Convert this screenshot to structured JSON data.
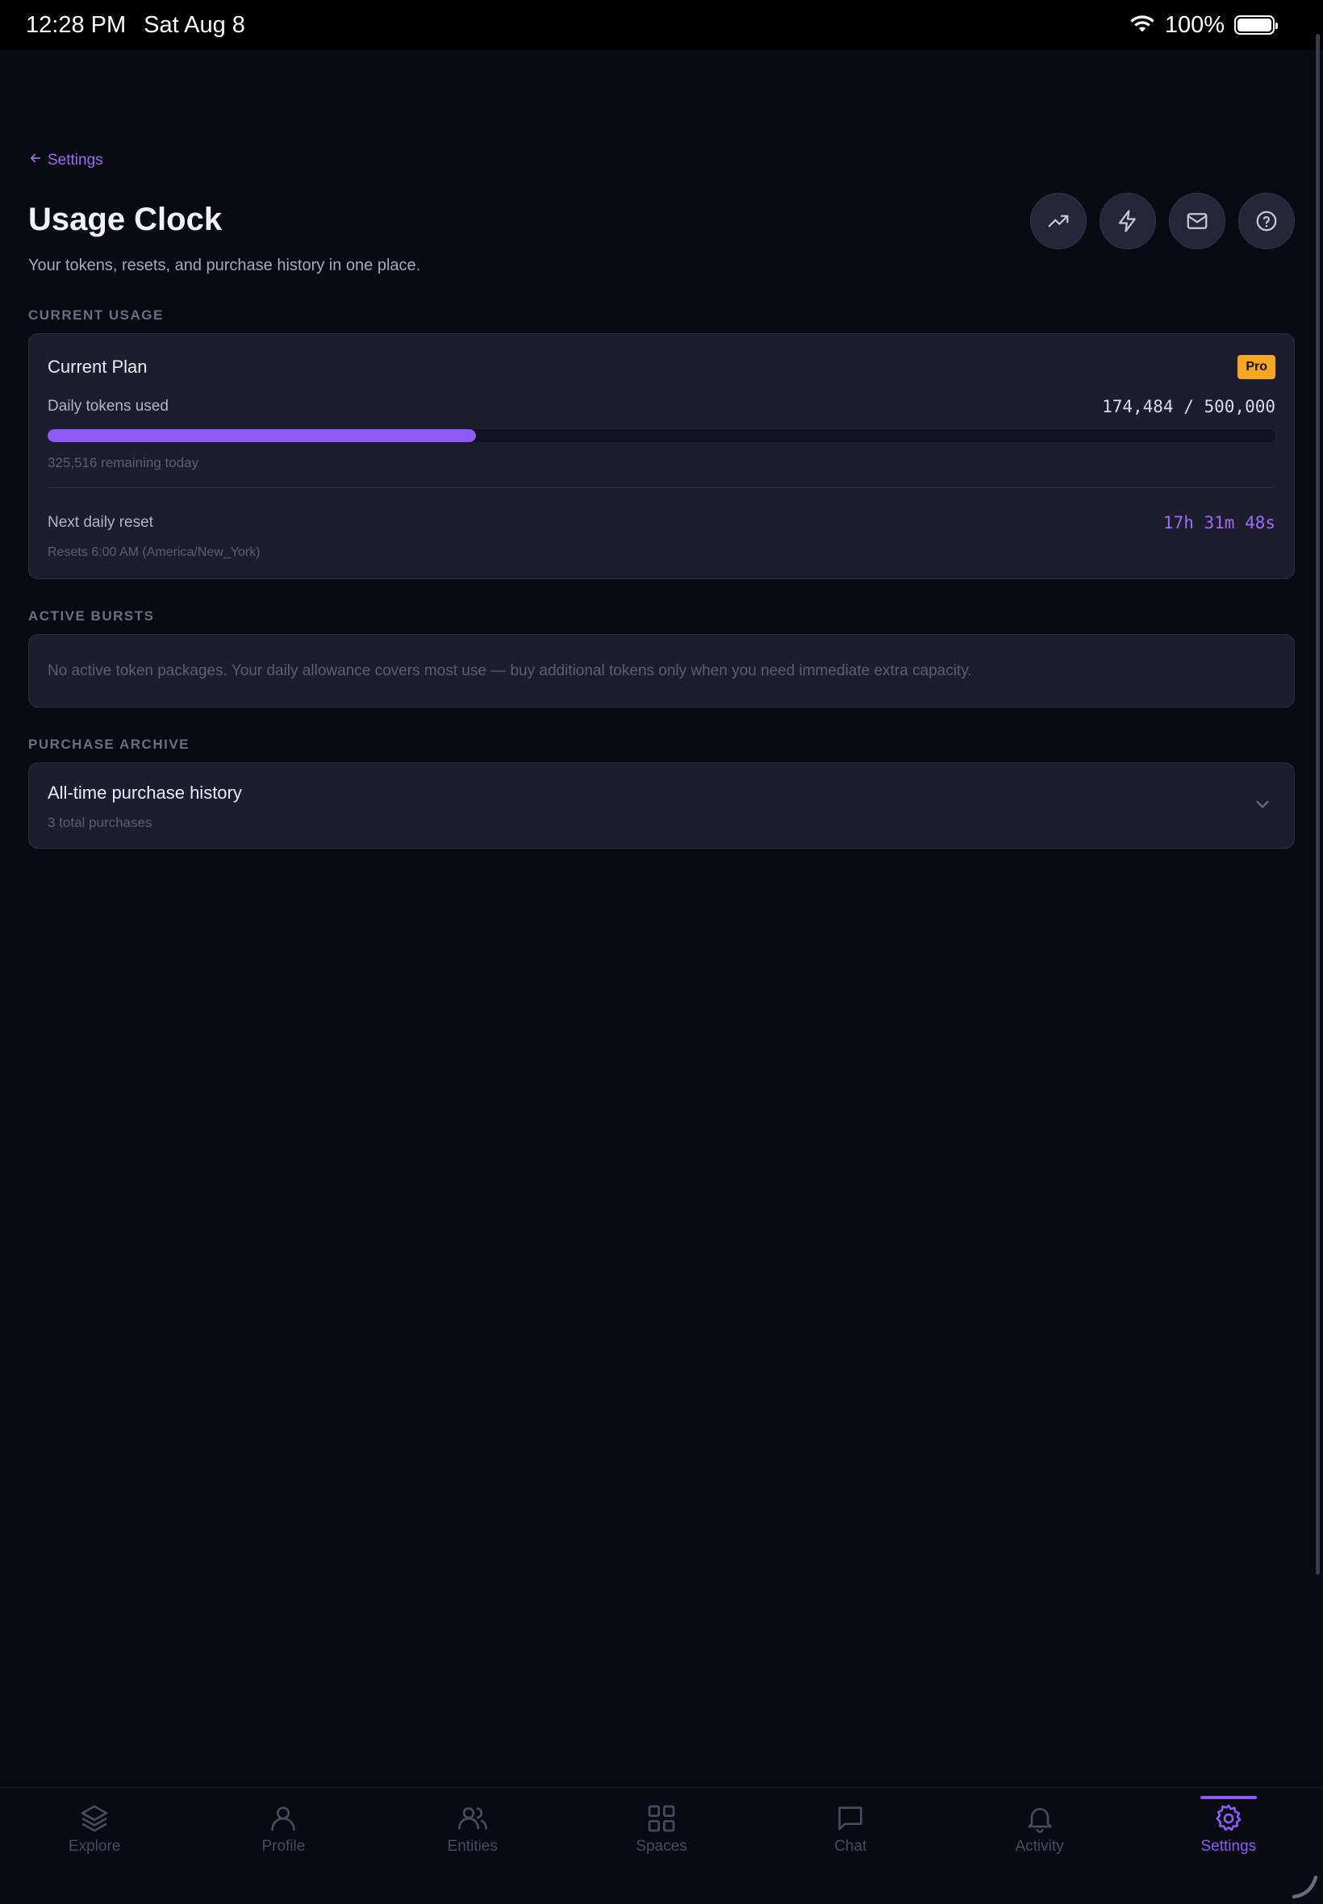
{
  "status": {
    "time": "12:28 PM",
    "date": "Sat Aug 8",
    "battery": "100%"
  },
  "header": {
    "back_label": "Settings",
    "title": "Usage Clock",
    "subtitle": "Your tokens, resets, and purchase history in one place.",
    "actions": [
      {
        "icon": "trending-up-icon"
      },
      {
        "icon": "lightning-icon"
      },
      {
        "icon": "mail-icon"
      },
      {
        "icon": "help-icon"
      }
    ]
  },
  "current_usage": {
    "section_label": "CURRENT USAGE",
    "plan_title": "Current Plan",
    "plan_badge": "Pro",
    "tokens_label": "Daily tokens used",
    "tokens_value": "174,484 / 500,000",
    "tokens_used": 174484,
    "tokens_limit": 500000,
    "remaining": "325,516 remaining today",
    "reset_label": "Next daily reset",
    "countdown": "17h 31m 48s",
    "reset_sub": "Resets 6:00 AM (America/New_York)"
  },
  "active_bursts": {
    "section_label": "ACTIVE BURSTS",
    "empty_text": "No active token packages. Your daily allowance covers most use — buy additional tokens only when you need immediate extra capacity."
  },
  "purchase_archive": {
    "section_label": "PURCHASE ARCHIVE",
    "title": "All-time purchase history",
    "count": "3 total purchases"
  },
  "tabs": [
    {
      "label": "Explore",
      "icon": "layers-icon"
    },
    {
      "label": "Profile",
      "icon": "user-icon"
    },
    {
      "label": "Entities",
      "icon": "users-icon"
    },
    {
      "label": "Spaces",
      "icon": "grid-icon"
    },
    {
      "label": "Chat",
      "icon": "chat-icon"
    },
    {
      "label": "Activity",
      "icon": "bell-icon"
    },
    {
      "label": "Settings",
      "icon": "gear-icon",
      "active": true
    }
  ],
  "colors": {
    "accent": "#8b5cf6",
    "badge": "#f5a623",
    "background": "#0a0a12",
    "card": "#1d1d2e"
  }
}
